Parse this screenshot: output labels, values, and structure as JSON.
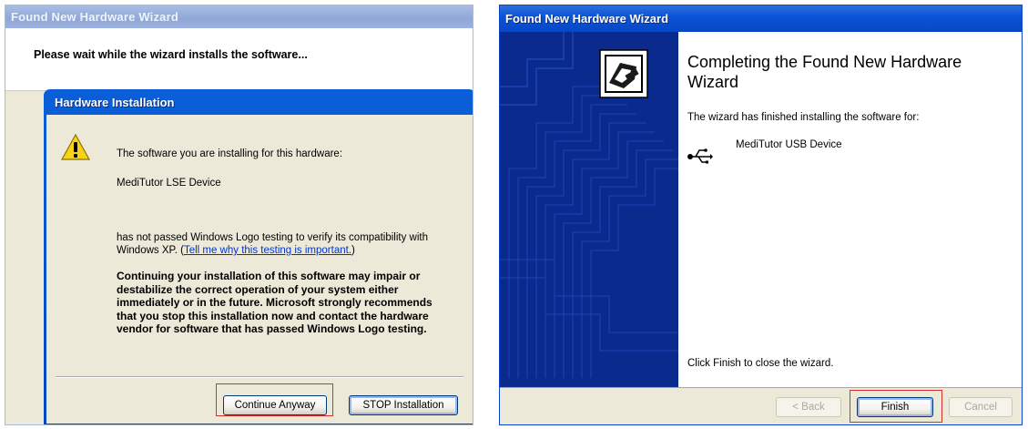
{
  "left_window": {
    "title": "Found New Hardware Wizard",
    "header_text": "Please wait while the wizard installs the software..."
  },
  "hardware_dialog": {
    "title": "Hardware Installation",
    "icon": "warning-icon",
    "line1": "The software you are installing for this hardware:",
    "device": "MediTutor LSE Device",
    "para_prefix": "has not passed Windows Logo testing to verify its compatibility with Windows XP. (",
    "link_text": "Tell me why this testing is important.",
    "para_suffix": ")",
    "bold_warning": "Continuing your installation of this software may impair or destabilize the correct operation of your system either immediately or in the future. Microsoft strongly recommends that you stop this installation now and contact the hardware vendor for software that has passed Windows Logo testing.",
    "continue_label": "Continue Anyway",
    "stop_label": "STOP Installation"
  },
  "right_window": {
    "title": "Found New Hardware Wizard",
    "heading": "Completing the Found New Hardware Wizard",
    "finished_text": "The wizard has finished installing the software for:",
    "device_icon": "usb-icon",
    "device_name": "MediTutor USB Device",
    "finish_hint": "Click Finish to close the wizard.",
    "back_label": "< Back",
    "finish_label": "Finish",
    "cancel_label": "Cancel"
  },
  "colors": {
    "xp_blue": "#0847c4",
    "banner_blue": "#0b2a8e",
    "highlight_red": "#d9302c",
    "dialog_face": "#ece9d8"
  }
}
